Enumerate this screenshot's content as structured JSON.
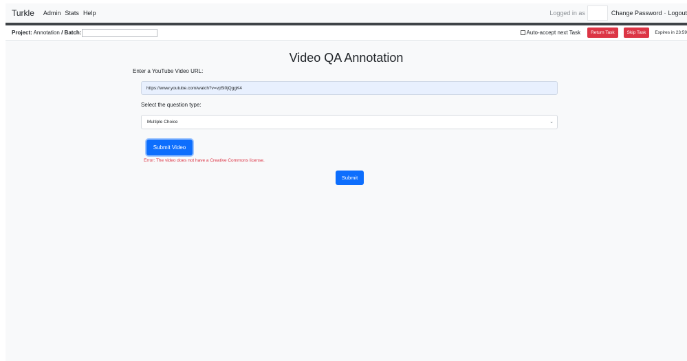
{
  "nav": {
    "brand": "Turkle",
    "links": [
      "Admin",
      "Stats",
      "Help"
    ],
    "logged_in_label": "Logged in as",
    "change_password": "Change Password",
    "separator": "-",
    "logout": "Logout"
  },
  "taskbar": {
    "project_label": "Project:",
    "project_name": "Annotation",
    "slash": "/",
    "batch_label": "Batch:",
    "auto_accept": "Auto-accept next Task",
    "return_task": "Return Task",
    "skip_task": "Skip Task",
    "expires": "Expires in 23:59"
  },
  "form": {
    "title": "Video QA Annotation",
    "url_label": "Enter a YouTube Video URL:",
    "url_value": "https://www.youtube.com/watch?v=vp5i0jQggK4",
    "type_label": "Select the question type:",
    "type_selected": "Multiple Choice",
    "submit_video": "Submit Video",
    "error": "Error: The video does not have a Creative Commons license.",
    "submit": "Submit"
  },
  "colors": {
    "primary": "#0d6efd",
    "danger": "#dc3545",
    "navbar_bg": "#f8f9fa",
    "dark_strip": "#3f4347"
  },
  "icons": {
    "select_chevron": "chevron-down-icon"
  }
}
